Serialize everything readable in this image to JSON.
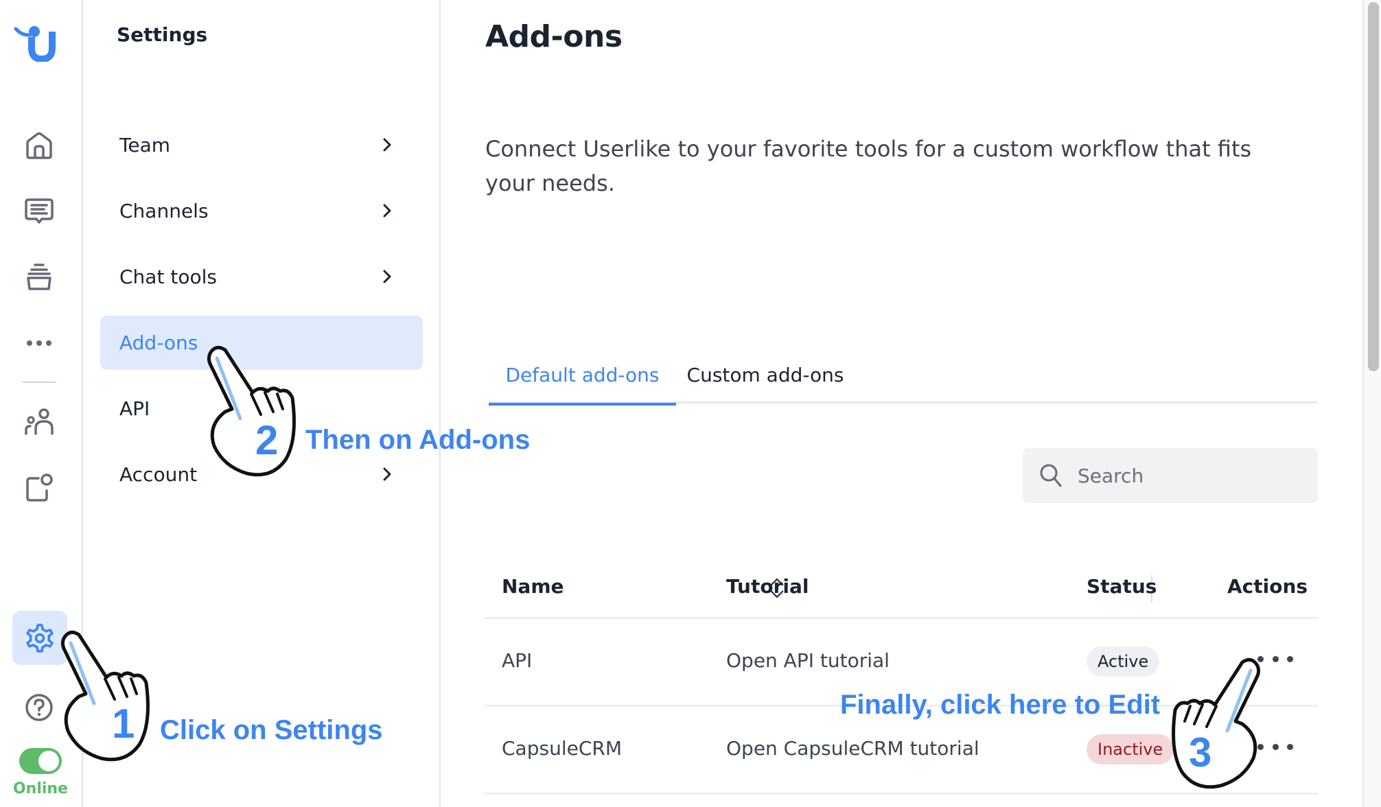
{
  "rail": {
    "logo": "userlike-logo",
    "items": [
      {
        "name": "home",
        "icon": "home-icon"
      },
      {
        "name": "chat",
        "icon": "chat-icon"
      },
      {
        "name": "inbox",
        "icon": "inbox-icon"
      },
      {
        "name": "more",
        "icon": "more-icon"
      },
      {
        "name": "contacts",
        "icon": "people-icon"
      },
      {
        "name": "addons",
        "icon": "widget-icon"
      }
    ],
    "settings_icon": "gear-icon",
    "help_icon": "help-icon",
    "status_label": "Online",
    "status_on": true
  },
  "sidebar": {
    "title": "Settings",
    "items": [
      {
        "label": "Team",
        "has_chevron": true,
        "active": false
      },
      {
        "label": "Channels",
        "has_chevron": true,
        "active": false
      },
      {
        "label": "Chat tools",
        "has_chevron": true,
        "active": false
      },
      {
        "label": "Add-ons",
        "has_chevron": false,
        "active": true
      },
      {
        "label": "API",
        "has_chevron": false,
        "active": false
      },
      {
        "label": "Account",
        "has_chevron": true,
        "active": false
      }
    ]
  },
  "main": {
    "title": "Add-ons",
    "description": "Connect Userlike to your favorite tools for a custom workflow that fits your needs.",
    "tabs": [
      {
        "label": "Default add-ons",
        "active": true
      },
      {
        "label": "Custom add-ons",
        "active": false
      }
    ],
    "search": {
      "placeholder": "Search",
      "value": ""
    },
    "table": {
      "columns": [
        "Name",
        "Tutorial",
        "Status",
        "Actions"
      ],
      "rows": [
        {
          "name": "API",
          "tutorial": "Open API tutorial",
          "status": "Active"
        },
        {
          "name": "CapsuleCRM",
          "tutorial": "Open CapsuleCRM tutorial",
          "status": "Inactive"
        }
      ]
    }
  },
  "annotations": [
    {
      "step": "1",
      "text": "Click on Settings"
    },
    {
      "step": "2",
      "text": "Then on Add-ons"
    },
    {
      "step": "3",
      "text": "Finally, click here to Edit"
    }
  ],
  "colors": {
    "accent": "#3d85f0",
    "active_bg": "#dfeafc",
    "online": "#5dbb6a",
    "inactive_badge_bg": "#f6d7d9",
    "inactive_badge_text": "#8c1c22",
    "active_badge_bg": "#eef0f4"
  }
}
